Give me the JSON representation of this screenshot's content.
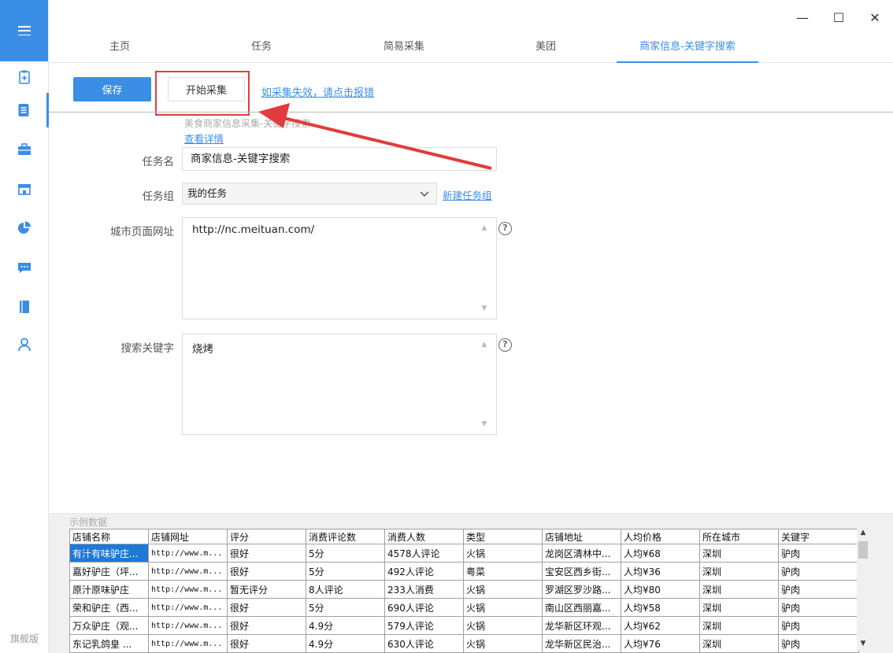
{
  "sidebar": {
    "edition": "旗舰版",
    "items": [
      {
        "icon": "clipboard-add-icon"
      },
      {
        "icon": "document-icon",
        "active": true
      },
      {
        "icon": "briefcase-icon"
      },
      {
        "icon": "store-icon"
      },
      {
        "icon": "pie-chart-icon"
      },
      {
        "icon": "chat-icon"
      },
      {
        "icon": "book-icon"
      },
      {
        "icon": "user-icon"
      }
    ]
  },
  "window": {
    "minimize": "—",
    "maximize": "☐",
    "close": "✕"
  },
  "tabs": [
    "主页",
    "任务",
    "简易采集",
    "美团",
    "商家信息-关键字搜索"
  ],
  "toolbar": {
    "save_label": "保存",
    "start_label": "开始采集",
    "report_link": "如采集失效，请点击报错"
  },
  "description": "美食商家信息采集-关键字搜索",
  "detail_link": "查看详情",
  "form": {
    "task_name_label": "任务名",
    "task_name_value": "商家信息-关键字搜索",
    "task_group_label": "任务组",
    "task_group_value": "我的任务",
    "new_group_link": "新建任务组",
    "city_url_label": "城市页面网址",
    "city_url_value": "http://nc.meituan.com/",
    "keyword_label": "搜索关键字",
    "keyword_value": "烧烤",
    "help_glyph": "?"
  },
  "sample": {
    "label": "示例数据",
    "columns": [
      "店铺名称",
      "店铺网址",
      "评分",
      "消费评论数",
      "消费人数",
      "类型",
      "店铺地址",
      "人均价格",
      "所在城市",
      "关键字"
    ],
    "rows": [
      [
        "有汁有味驴庄...",
        "http://www.m...",
        "很好",
        "5分",
        "4578人评论",
        "火锅",
        "龙岗区清林中...",
        "人均¥68",
        "深圳",
        "驴肉"
      ],
      [
        "嘉好驴庄（坪...",
        "http://www.m...",
        "很好",
        "5分",
        "492人评论",
        "粤菜",
        "宝安区西乡街...",
        "人均¥36",
        "深圳",
        "驴肉"
      ],
      [
        "原汁原味驴庄",
        "http://www.m...",
        "暂无评分",
        "8人评论",
        "233人消费",
        "火锅",
        "罗湖区罗沙路...",
        "人均¥80",
        "深圳",
        "驴肉"
      ],
      [
        "荣和驴庄（西...",
        "http://www.m...",
        "很好",
        "5分",
        "690人评论",
        "火锅",
        "南山区西丽嘉...",
        "人均¥58",
        "深圳",
        "驴肉"
      ],
      [
        "万众驴庄（观...",
        "http://www.m...",
        "很好",
        "4.9分",
        "579人评论",
        "火锅",
        "龙华新区环观...",
        "人均¥62",
        "深圳",
        "驴肉"
      ],
      [
        "东记乳鸽皇 ...",
        "http://www.m...",
        "很好",
        "4.9分",
        "630人评论",
        "火锅",
        "龙华新区民治...",
        "人均¥76",
        "深圳",
        "驴肉"
      ]
    ]
  },
  "colors": {
    "accent": "#3a8ee6",
    "highlight": "#e03c3c"
  }
}
